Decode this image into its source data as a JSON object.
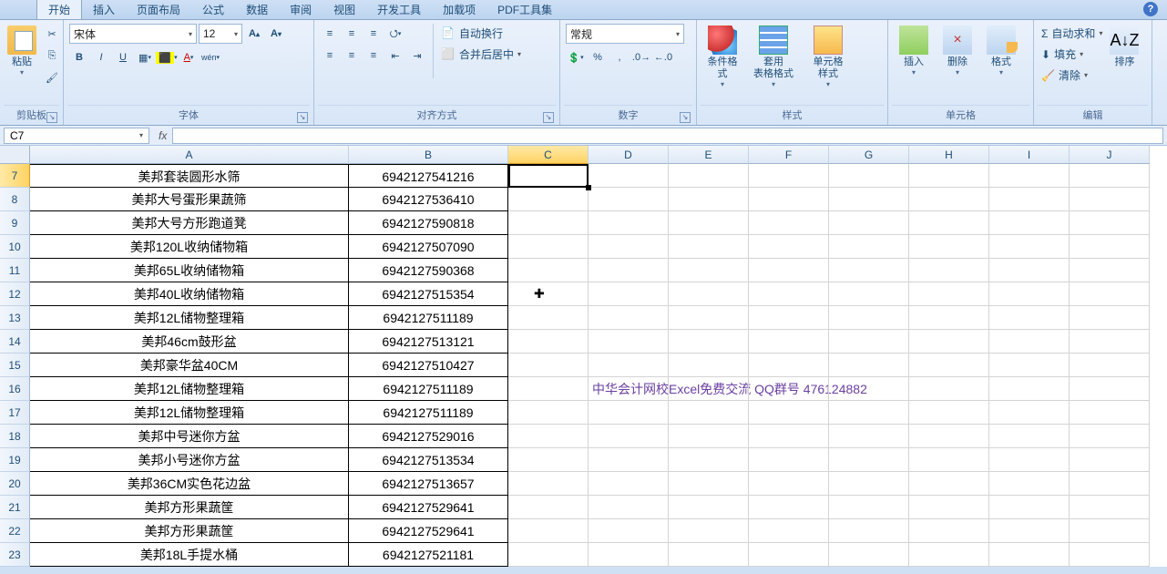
{
  "tabs": [
    "开始",
    "插入",
    "页面布局",
    "公式",
    "数据",
    "审阅",
    "视图",
    "开发工具",
    "加载项",
    "PDF工具集"
  ],
  "active_tab_index": 0,
  "ribbon": {
    "clipboard": {
      "paste": "粘贴",
      "label": "剪贴板"
    },
    "font": {
      "label": "字体",
      "name": "宋体",
      "size": "12",
      "btns": {
        "bold": "B",
        "italic": "I",
        "underline": "U"
      }
    },
    "align": {
      "label": "对齐方式",
      "wrap": "自动换行",
      "merge": "合并后居中"
    },
    "number": {
      "label": "数字",
      "format": "常规"
    },
    "styles": {
      "label": "样式",
      "cond": "条件格式",
      "table": "套用\n表格格式",
      "cell": "单元格\n样式"
    },
    "cells": {
      "label": "单元格",
      "insert": "插入",
      "delete": "删除",
      "format": "格式"
    },
    "edit": {
      "label": "编辑",
      "sum": "自动求和",
      "fill": "填充",
      "clear": "清除",
      "sort": "排序"
    }
  },
  "namebox": "C7",
  "colheaders": [
    "A",
    "B",
    "C",
    "D",
    "E",
    "F",
    "G",
    "H",
    "I",
    "J"
  ],
  "rows": [
    {
      "n": "7",
      "a": "美邦套装圆形水筛",
      "b": "6942127541216"
    },
    {
      "n": "8",
      "a": "美邦大号蛋形果蔬筛",
      "b": "6942127536410"
    },
    {
      "n": "9",
      "a": "美邦大号方形跑道凳",
      "b": "6942127590818"
    },
    {
      "n": "10",
      "a": "美邦120L收纳储物箱",
      "b": "6942127507090"
    },
    {
      "n": "11",
      "a": "美邦65L收纳储物箱",
      "b": "6942127590368"
    },
    {
      "n": "12",
      "a": "美邦40L收纳储物箱",
      "b": "6942127515354"
    },
    {
      "n": "13",
      "a": "美邦12L储物整理箱",
      "b": "6942127511189"
    },
    {
      "n": "14",
      "a": "美邦46cm鼓形盆",
      "b": "6942127513121"
    },
    {
      "n": "15",
      "a": "美邦豪华盆40CM",
      "b": "6942127510427"
    },
    {
      "n": "16",
      "a": "美邦12L储物整理箱",
      "b": "6942127511189"
    },
    {
      "n": "17",
      "a": "美邦12L储物整理箱",
      "b": "6942127511189"
    },
    {
      "n": "18",
      "a": "美邦中号迷你方盆",
      "b": "6942127529016"
    },
    {
      "n": "19",
      "a": "美邦小号迷你方盆",
      "b": "6942127513534"
    },
    {
      "n": "20",
      "a": "美邦36CM实色花边盆",
      "b": "6942127513657"
    },
    {
      "n": "21",
      "a": "美邦方形果蔬筐",
      "b": "6942127529641"
    },
    {
      "n": "22",
      "a": "美邦方形果蔬筐",
      "b": "6942127529641"
    },
    {
      "n": "23",
      "a": "美邦18L手提水桶",
      "b": "6942127521181"
    }
  ],
  "annotation": {
    "row_index": 9,
    "text": "中华会计网校Excel免费交流  QQ群号   476124882"
  },
  "selected_cell": "C7",
  "selected_col": "C",
  "selected_row": "7",
  "help_icon": "?"
}
